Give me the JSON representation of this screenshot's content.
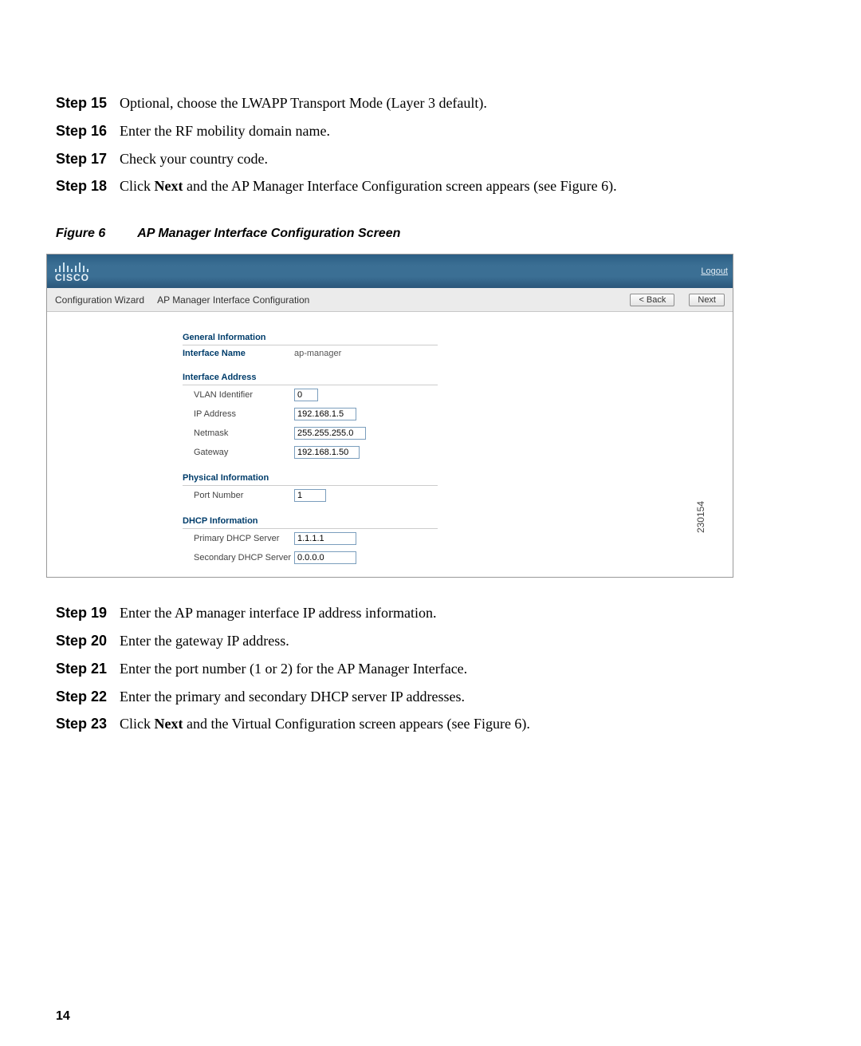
{
  "steps_before": [
    {
      "num": "Step 15",
      "text": "Optional, choose the LWAPP Transport Mode (Layer 3 default)."
    },
    {
      "num": "Step 16",
      "text": "Enter the RF mobility domain name."
    },
    {
      "num": "Step 17",
      "text": "Check your country code."
    },
    {
      "num": "Step 18",
      "text_before": "Click ",
      "bold": "Next",
      "text_after": " and the AP Manager Interface Configuration screen appears (see Figure 6)."
    }
  ],
  "figure": {
    "label": "Figure 6",
    "title": "AP Manager Interface Configuration Screen",
    "ref_id": "230154"
  },
  "screenshot": {
    "brand": "CISCO",
    "logout": "Logout",
    "wizard_label": "Configuration Wizard",
    "page_title": "AP Manager Interface Configuration",
    "btn_back": "< Back",
    "btn_next": "Next",
    "sections": {
      "general": {
        "heading": "General Information",
        "interface_name_label": "Interface Name",
        "interface_name_value": "ap-manager"
      },
      "iface_addr": {
        "heading": "Interface Address",
        "vlan_label": "VLAN Identifier",
        "vlan_value": "0",
        "ip_label": "IP Address",
        "ip_value": "192.168.1.5",
        "netmask_label": "Netmask",
        "netmask_value": "255.255.255.0",
        "gateway_label": "Gateway",
        "gateway_value": "192.168.1.50"
      },
      "physical": {
        "heading": "Physical Information",
        "port_label": "Port Number",
        "port_value": "1"
      },
      "dhcp": {
        "heading": "DHCP Information",
        "primary_label": "Primary DHCP Server",
        "primary_value": "1.1.1.1",
        "secondary_label": "Secondary DHCP Server",
        "secondary_value": "0.0.0.0"
      }
    }
  },
  "steps_after": [
    {
      "num": "Step 19",
      "text": "Enter the AP manager interface IP address information."
    },
    {
      "num": "Step 20",
      "text": "Enter the gateway IP address."
    },
    {
      "num": "Step 21",
      "text": "Enter the port number (1 or 2) for the AP Manager Interface."
    },
    {
      "num": "Step 22",
      "text": "Enter the primary and secondary DHCP server IP addresses."
    },
    {
      "num": "Step 23",
      "text_before": "Click ",
      "bold": "Next",
      "text_after": " and the Virtual Configuration screen appears (see Figure 6)."
    }
  ],
  "page_number": "14"
}
